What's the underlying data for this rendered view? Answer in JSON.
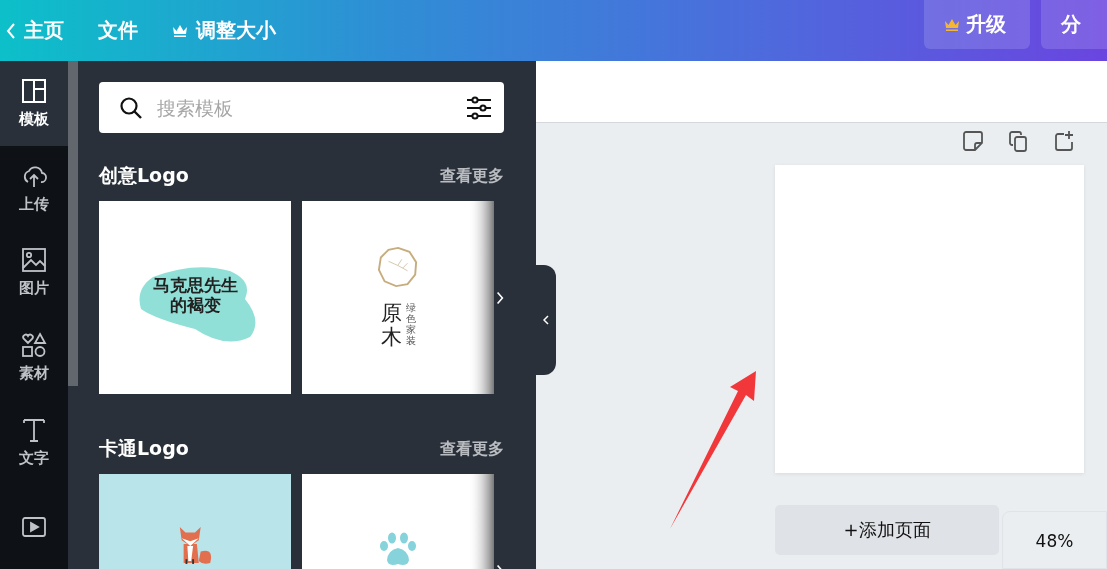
{
  "header": {
    "back": {
      "label": "主页"
    },
    "menu": [
      {
        "label": "文件",
        "premium": false
      },
      {
        "label": "调整大小",
        "premium": true
      }
    ],
    "actions": [
      {
        "label": "升级",
        "premium": true
      },
      {
        "label": "分",
        "premium": false
      }
    ]
  },
  "rail": [
    {
      "label": "模板",
      "selected": true
    },
    {
      "label": "上传",
      "selected": false
    },
    {
      "label": "图片",
      "selected": false
    },
    {
      "label": "素材",
      "selected": false
    },
    {
      "label": "文字",
      "selected": false
    },
    {
      "selected": false
    }
  ],
  "search": {
    "placeholder": "搜索模板"
  },
  "sections": [
    {
      "title": "创意Logo",
      "more": "查看更多",
      "cards": [
        {
          "kind": "brush",
          "lines": [
            "马克思先生",
            "的褐变"
          ]
        },
        {
          "kind": "wood",
          "title": "原木",
          "subtitle": "绿色家装"
        }
      ]
    },
    {
      "title": "卡通Logo",
      "more": "查看更多",
      "cards": [
        {
          "kind": "fox"
        },
        {
          "kind": "paw"
        }
      ]
    }
  ],
  "canvas": {
    "add_page": "+添加页面",
    "zoom": "48%"
  }
}
